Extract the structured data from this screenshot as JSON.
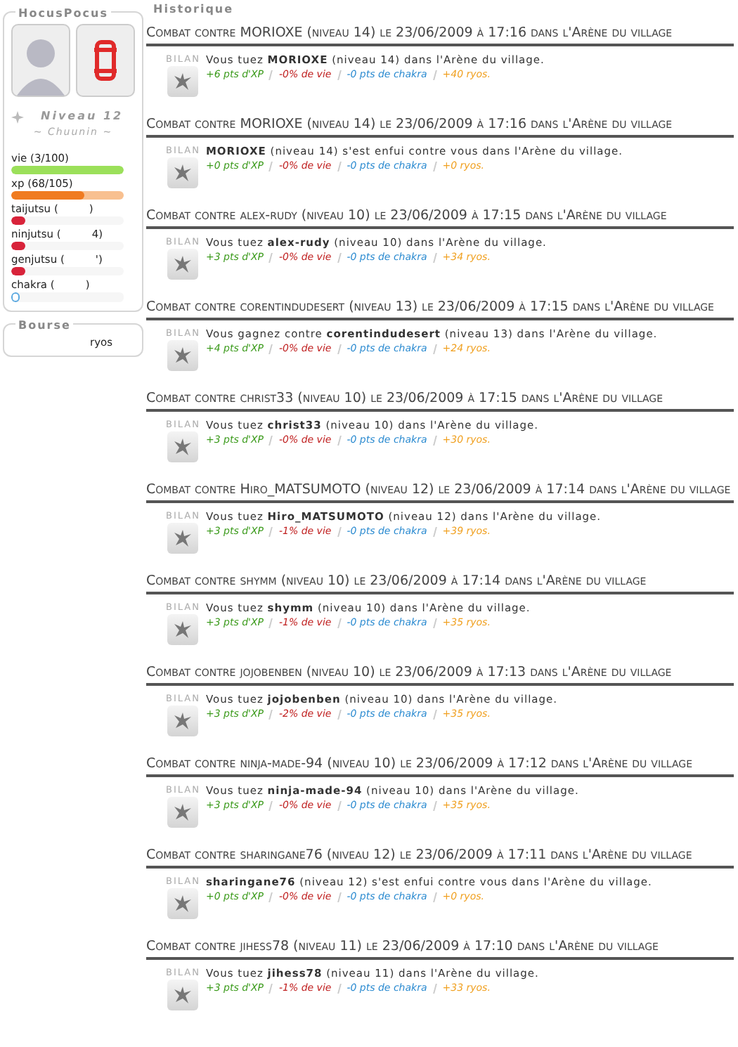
{
  "profile": {
    "legend": "HocusPocus",
    "level": "Niveau 12",
    "rank": "~ Chuunin ~",
    "stats": [
      {
        "label": "vie (3/100)",
        "level": 1.0,
        "color": "#9be05a",
        "kind": "bar"
      },
      {
        "label": "xp (68/105)",
        "level": 0.65,
        "color": "#f07b20",
        "kind": "bar"
      },
      {
        "label": "taijutsu (",
        "suffix": ")",
        "level": 0.13,
        "color": "#d8233a",
        "kind": "pill"
      },
      {
        "label": "ninjutsu (",
        "suffix": "4)",
        "level": 0.13,
        "color": "#d8233a",
        "kind": "pill"
      },
      {
        "label": "genjutsu (",
        "suffix": "')",
        "level": 0.13,
        "color": "#d8233a",
        "kind": "pill"
      },
      {
        "label": "chakra (",
        "suffix": ")",
        "level": 0.08,
        "color": "#5aa8e0",
        "kind": "outline"
      }
    ]
  },
  "purse": {
    "legend": "Bourse",
    "unit": "ryos"
  },
  "history": {
    "legend": "Historique",
    "entries": [
      {
        "title": "Combat contre MORIOXE (niveau 14) le 23/06/2009 à 17:16 dans l'Arène du village",
        "label": "BILAN",
        "message": "Vous tuez **MORIOXE** (niveau 14) dans l'Arène du village.",
        "xp": "+6 pts d'XP",
        "vie": "-0% de vie",
        "chakra": "-0 pts de chakra",
        "ryos": "+40 ryos."
      },
      {
        "title": "Combat contre MORIOXE (niveau 14) le 23/06/2009 à 17:16 dans l'Arène du village",
        "label": "BILAN",
        "message": "**MORIOXE** (niveau 14) s'est enfui contre vous dans l'Arène du village.",
        "xp": "+0 pts d'XP",
        "vie": "-0% de vie",
        "chakra": "-0 pts de chakra",
        "ryos": "+0 ryos."
      },
      {
        "title": "Combat contre alex-rudy (niveau 10) le 23/06/2009 à 17:15 dans l'Arène du village",
        "label": "BILAN",
        "message": "Vous tuez **alex-rudy** (niveau 10) dans l'Arène du village.",
        "xp": "+3 pts d'XP",
        "vie": "-0% de vie",
        "chakra": "-0 pts de chakra",
        "ryos": "+34 ryos."
      },
      {
        "title": "Combat contre corentindudesert (niveau 13) le 23/06/2009 à 17:15 dans l'Arène du village",
        "label": "BILAN",
        "message": "Vous gagnez contre **corentindudesert** (niveau 13) dans l'Arène du village.",
        "xp": "+4 pts d'XP",
        "vie": "-0% de vie",
        "chakra": "-0 pts de chakra",
        "ryos": "+24 ryos."
      },
      {
        "title": "Combat contre christ33 (niveau 10) le 23/06/2009 à 17:15 dans l'Arène du village",
        "label": "BILAN",
        "message": "Vous tuez **christ33** (niveau 10) dans l'Arène du village.",
        "xp": "+3 pts d'XP",
        "vie": "-0% de vie",
        "chakra": "-0 pts de chakra",
        "ryos": "+30 ryos."
      },
      {
        "title": "Combat contre Hiro_MATSUMOTO (niveau 12) le 23/06/2009 à 17:14 dans l'Arène du village",
        "label": "BILAN",
        "message": "Vous tuez **Hiro_MATSUMOTO** (niveau 12) dans l'Arène du village.",
        "xp": "+3 pts d'XP",
        "vie": "-1% de vie",
        "chakra": "-0 pts de chakra",
        "ryos": "+39 ryos."
      },
      {
        "title": "Combat contre shymm (niveau 10) le 23/06/2009 à 17:14 dans l'Arène du village",
        "label": "BILAN",
        "message": "Vous tuez **shymm** (niveau 10) dans l'Arène du village.",
        "xp": "+3 pts d'XP",
        "vie": "-1% de vie",
        "chakra": "-0 pts de chakra",
        "ryos": "+35 ryos."
      },
      {
        "title": "Combat contre jojobenben (niveau 10) le 23/06/2009 à 17:13 dans l'Arène du village",
        "label": "BILAN",
        "message": "Vous tuez **jojobenben** (niveau 10) dans l'Arène du village.",
        "xp": "+3 pts d'XP",
        "vie": "-2% de vie",
        "chakra": "-0 pts de chakra",
        "ryos": "+35 ryos."
      },
      {
        "title": "Combat contre ninja-made-94 (niveau 10) le 23/06/2009 à 17:12 dans l'Arène du village",
        "label": "BILAN",
        "message": "Vous tuez **ninja-made-94** (niveau 10) dans l'Arène du village.",
        "xp": "+3 pts d'XP",
        "vie": "-0% de vie",
        "chakra": "-0 pts de chakra",
        "ryos": "+35 ryos."
      },
      {
        "title": "Combat contre sharingane76 (niveau 12) le 23/06/2009 à 17:11 dans l'Arène du village",
        "label": "BILAN",
        "message": "**sharingane76** (niveau 12) s'est enfui contre vous dans l'Arène du village.",
        "xp": "+0 pts d'XP",
        "vie": "-0% de vie",
        "chakra": "-0 pts de chakra",
        "ryos": "+0 ryos."
      },
      {
        "title": "Combat contre jihess78 (niveau 11) le 23/06/2009 à 17:10 dans l'Arène du village",
        "label": "BILAN",
        "message": "Vous tuez **jihess78** (niveau 11) dans l'Arène du village.",
        "xp": "+3 pts d'XP",
        "vie": "-1% de vie",
        "chakra": "-0 pts de chakra",
        "ryos": "+33 ryos."
      }
    ]
  }
}
